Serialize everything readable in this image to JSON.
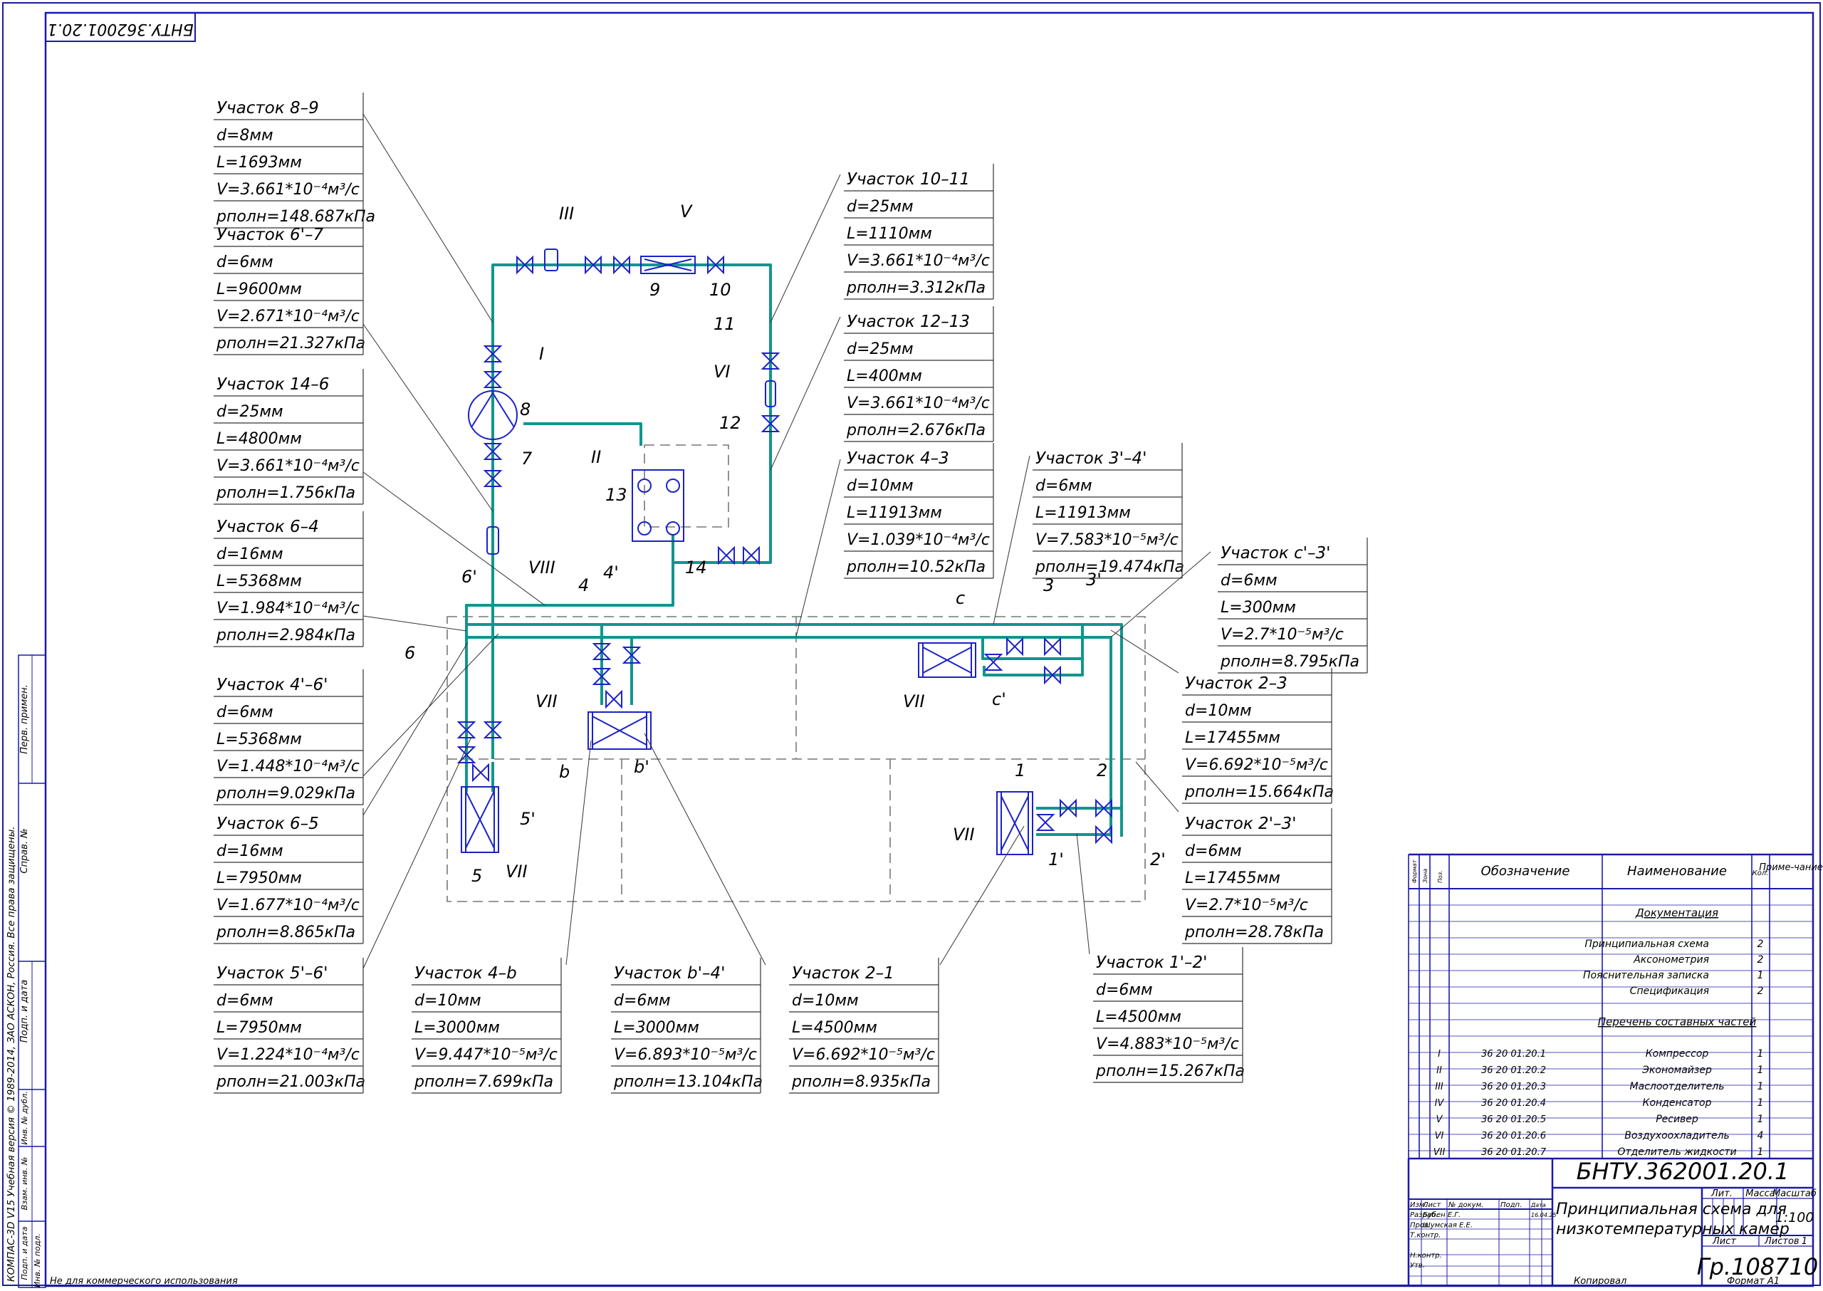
{
  "stamp": {
    "corner_code": "БНТУ.362001.20.1",
    "doc_code": "БНТУ.362001.20.1",
    "title_line1": "Принципиальная схема для",
    "title_line2": "низкотемпературных камер",
    "group": "Гр.108710",
    "scale": "1:100",
    "sheet_label": "Лист",
    "sheets_label": "Листов",
    "sheets_count": "1",
    "lit_label": "Лит.",
    "mass_label": "Масса",
    "scale_label": "Масштаб",
    "rows": [
      {
        "role": "Изм.",
        "name": "Лист",
        "num": "№ докум.",
        "sign": "Подп.",
        "date": "Дата"
      },
      {
        "role": "Разраб.",
        "name": "Бубен Е.Г.",
        "num": "",
        "sign": "",
        "date": "16.04.25"
      },
      {
        "role": "Пров.",
        "name": "Шумская Е.Е.",
        "num": "",
        "sign": "",
        "date": ""
      },
      {
        "role": "Т.контр.",
        "name": "",
        "num": "",
        "sign": "",
        "date": ""
      },
      {
        "role": "",
        "name": "",
        "num": "",
        "sign": "",
        "date": ""
      },
      {
        "role": "Н.контр.",
        "name": "",
        "num": "",
        "sign": "",
        "date": ""
      },
      {
        "role": "Утв.",
        "name": "",
        "num": "",
        "sign": "",
        "date": ""
      }
    ],
    "footer_left": "Не для коммерческого использования",
    "footer_copy": "Копировал",
    "footer_format": "Формат   А1"
  },
  "side_stamp": {
    "vertical_notice": "КОМПАС-3D V15 Учебная версия © 1989-2014, ЗАО АСКОН, Россия. Все права защищены.",
    "cells": [
      "Перв. примен.",
      "Справ. №",
      "Подп. и дата",
      "Инв. № дубл.",
      "Взам. инв. №",
      "Подп. и дата",
      "Инв. № подл."
    ]
  },
  "spec": {
    "col_headers": {
      "format": "Формат",
      "zone": "Зона",
      "pos": "Поз.",
      "designation": "Обозначение",
      "name": "Наименование",
      "qty": "Кол.",
      "note": "Приме-чание"
    },
    "section_docs": "Документация",
    "docs": [
      {
        "name": "Принципиальная схема",
        "qty": "2"
      },
      {
        "name": "Аксонометрия",
        "qty": "2"
      },
      {
        "name": "Пояснительная записка",
        "qty": "1"
      },
      {
        "name": "Спецификация",
        "qty": "2"
      }
    ],
    "section_parts": "Перечень составных частей",
    "parts": [
      {
        "pos": "I",
        "designation": "36 20 01.20.1",
        "name": "Компрессор",
        "qty": "1"
      },
      {
        "pos": "II",
        "designation": "36 20 01.20.2",
        "name": "Экономайзер",
        "qty": "1"
      },
      {
        "pos": "III",
        "designation": "36 20 01.20.3",
        "name": "Маслоотделитель",
        "qty": "1"
      },
      {
        "pos": "IV",
        "designation": "36 20 01.20.4",
        "name": "Конденсатор",
        "qty": "1"
      },
      {
        "pos": "V",
        "designation": "36 20 01.20.5",
        "name": "Ресивер",
        "qty": "1"
      },
      {
        "pos": "VI",
        "designation": "36 20 01.20.6",
        "name": "Воздухоохладитель",
        "qty": "4"
      },
      {
        "pos": "VII",
        "designation": "36 20 01.20.7",
        "name": "Отделитель жидкости",
        "qty": "1"
      }
    ]
  },
  "sections": [
    {
      "title": "Участок 8–9",
      "d": "d=8мм",
      "L": "L=1693мм",
      "V": "V=3.661*10⁻⁴м³/с",
      "p": "pполн=148.687кПа"
    },
    {
      "title": "Участок 6'–7",
      "d": "d=6мм",
      "L": "L=9600мм",
      "V": "V=2.671*10⁻⁴м³/с",
      "p": "pполн=21.327кПа"
    },
    {
      "title": "Участок 14–6",
      "d": "d=25мм",
      "L": "L=4800мм",
      "V": "V=3.661*10⁻⁴м³/с",
      "p": "pполн=1.756кПа"
    },
    {
      "title": "Участок 6–4",
      "d": "d=16мм",
      "L": "L=5368мм",
      "V": "V=1.984*10⁻⁴м³/с",
      "p": "pполн=2.984кПа"
    },
    {
      "title": "Участок  4'–6'",
      "d": "d=6мм",
      "L": "L=5368мм",
      "V": "V=1.448*10⁻⁴м³/с",
      "p": "pполн=9.029кПа"
    },
    {
      "title": "Участок 6–5",
      "d": "d=16мм",
      "L": "L=7950мм",
      "V": "V=1.677*10⁻⁴м³/с",
      "p": "pполн=8.865кПа"
    },
    {
      "title": "Участок 5'–6'",
      "d": "d=6мм",
      "L": "L=7950мм",
      "V": "V=1.224*10⁻⁴м³/с",
      "p": "pполн=21.003кПа"
    },
    {
      "title": "Участок 4–b",
      "d": "d=10мм",
      "L": "L=3000мм",
      "V": "V=9.447*10⁻⁵м³/с",
      "p": "pполн=7.699кПа"
    },
    {
      "title": "Участок b'–4'",
      "d": "d=6мм",
      "L": "L=3000мм",
      "V": "V=6.893*10⁻⁵м³/с",
      "p": "pполн=13.104кПа"
    },
    {
      "title": "Участок 2–1",
      "d": "d=10мм",
      "L": "L=4500мм",
      "V": "V=6.692*10⁻⁵м³/с",
      "p": "pполн=8.935кПа"
    },
    {
      "title": "Участок 10–11",
      "d": "d=25мм",
      "L": "L=1110мм",
      "V": "V=3.661*10⁻⁴м³/с",
      "p": "pполн=3.312кПа"
    },
    {
      "title": "Участок 12–13",
      "d": "d=25мм",
      "L": "L=400мм",
      "V": "V=3.661*10⁻⁴м³/с",
      "p": "pполн=2.676кПа"
    },
    {
      "title": "Участок 4–3",
      "d": "d=10мм",
      "L": "L=11913мм",
      "V": "V=1.039*10⁻⁴м³/с",
      "p": "pполн=10.52кПа"
    },
    {
      "title": "Участок 3'–4'",
      "d": "d=6мм",
      "L": "L=11913мм",
      "V": "V=7.583*10⁻⁵м³/с",
      "p": "pполн=19.474кПа"
    },
    {
      "title": "Участок с'–3'",
      "d": "d=6мм",
      "L": "L=300мм",
      "V": "V=2.7*10⁻⁵м³/с",
      "p": "pполн=8.795кПа"
    },
    {
      "title": "Участок 2–3",
      "d": "d=10мм",
      "L": "L=17455мм",
      "V": "V=6.692*10⁻⁵м³/с",
      "p": "pполн=15.664кПа"
    },
    {
      "title": "Участок 2'–3'",
      "d": "d=6мм",
      "L": "L=17455мм",
      "V": "V=2.7*10⁻⁵м³/с",
      "p": "pполн=28.78кПа"
    },
    {
      "title": "Участок 1'–2'",
      "d": "d=6мм",
      "L": "L=4500мм",
      "V": "V=4.883*10⁻⁵м³/с",
      "p": "pполн=15.267кПа"
    }
  ],
  "labels": {
    "n1": "1",
    "n1p": "1'",
    "n2": "2",
    "n2p": "2'",
    "n3": "3",
    "n3p": "3'",
    "n4": "4",
    "n4p": "4'",
    "n5": "5",
    "n5p": "5'",
    "n6": "6",
    "n6p": "6'",
    "n7": "7",
    "n8": "8",
    "n9": "9",
    "n10": "10",
    "n11": "11",
    "n12": "12",
    "n13": "13",
    "n14": "14",
    "nb": "b",
    "nbp": "b'",
    "nc": "c",
    "ncp": "c'",
    "rI": "I",
    "rII": "II",
    "rIII": "III",
    "rV": "V",
    "rVI": "VI",
    "rVIII": "VIII",
    "rVII": "VII"
  },
  "colors": {
    "pipe": "#11958e",
    "equip": "#1c22c8",
    "border": "#1a1aa8",
    "dash": "#777777"
  }
}
